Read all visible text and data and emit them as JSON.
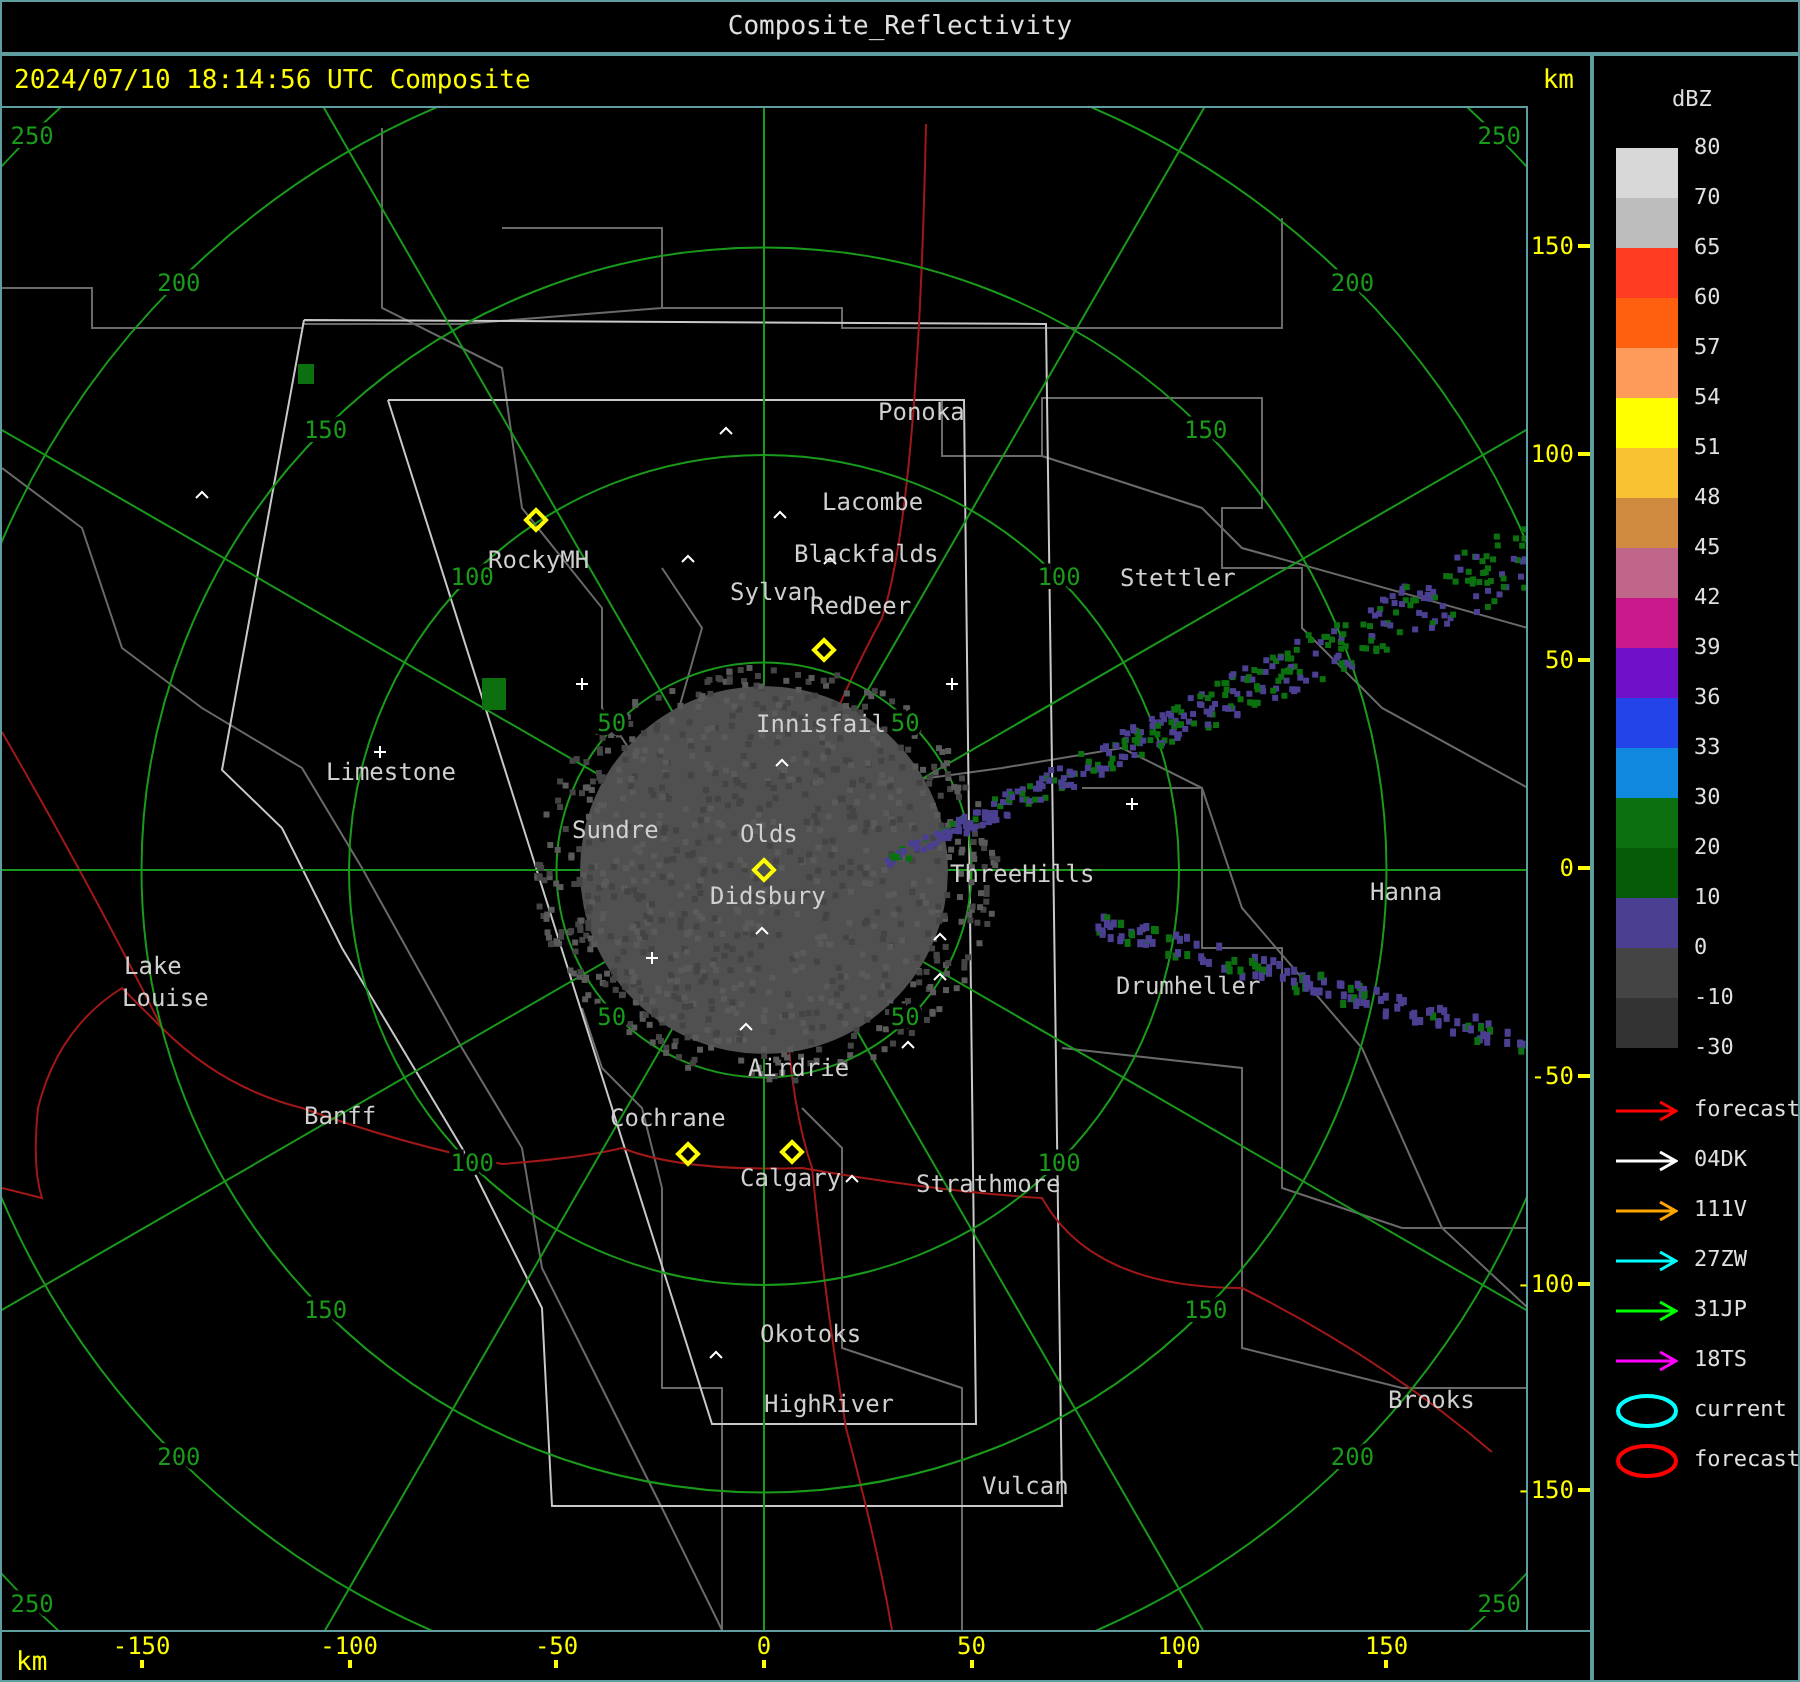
{
  "window": {
    "title": "Composite_Reflectivity"
  },
  "header": {
    "timestamp": "2024/07/10 18:14:56 UTC Composite",
    "unit": "km"
  },
  "map": {
    "range_labels": [
      "250",
      "200",
      "150",
      "100",
      "50",
      "50",
      "100",
      "150",
      "200",
      "250",
      "250",
      "200",
      "150",
      "100",
      "50",
      "50",
      "100",
      "150",
      "200",
      "250"
    ],
    "places": [
      "Ponoka",
      "Lacombe",
      "Blackfalds",
      "RockyMH",
      "Stettler",
      "Sylvan",
      "RedDeer",
      "Innisfail",
      "Limestone",
      "Sundre",
      "Olds",
      "ThreeHills",
      "Hanna",
      "Didsbury",
      "Lake",
      "Drumheller",
      "Louise",
      "Airdrie",
      "Banff",
      "Cochrane",
      "Calgary",
      "Strathmore",
      "Okotoks",
      "Brooks",
      "HighRiver",
      "Vulcan"
    ]
  },
  "y_axis": {
    "ticks": [
      "150",
      "100",
      "50",
      "0",
      "-50",
      "-100",
      "-150"
    ]
  },
  "x_axis": {
    "unit": "km",
    "ticks": [
      "-150",
      "-100",
      "-50",
      "0",
      "50",
      "100",
      "150"
    ]
  },
  "legend": {
    "unit": "dBZ",
    "bands": [
      {
        "label": "80",
        "color": "#d8d8d8"
      },
      {
        "label": "70",
        "color": "#bdbdbd"
      },
      {
        "label": "65",
        "color": "#ff3c22"
      },
      {
        "label": "60",
        "color": "#ff6010"
      },
      {
        "label": "57",
        "color": "#ff9b5a"
      },
      {
        "label": "54",
        "color": "#ffff00"
      },
      {
        "label": "51",
        "color": "#f8c233"
      },
      {
        "label": "48",
        "color": "#cf8a40"
      },
      {
        "label": "45",
        "color": "#c0668a"
      },
      {
        "label": "42",
        "color": "#c8188a"
      },
      {
        "label": "39",
        "color": "#7010c8"
      },
      {
        "label": "36",
        "color": "#2244e8"
      },
      {
        "label": "33",
        "color": "#1088e0"
      },
      {
        "label": "30",
        "color": "#0c7010"
      },
      {
        "label": "20",
        "color": "#055a05"
      },
      {
        "label": "10",
        "color": "#4a3f90"
      },
      {
        "label": "0",
        "color": "#444444"
      },
      {
        "label": "-10",
        "color": "#333333"
      }
    ],
    "bottom_label": "-30",
    "tracks": [
      {
        "kind": "arrow",
        "label": "forecast",
        "color": "#ff0000"
      },
      {
        "kind": "arrow",
        "label": "04DK",
        "color": "#ffffff"
      },
      {
        "kind": "arrow",
        "label": "111V",
        "color": "#ffa500"
      },
      {
        "kind": "arrow",
        "label": "27ZW",
        "color": "#00ffff"
      },
      {
        "kind": "arrow",
        "label": "31JP",
        "color": "#00ff00"
      },
      {
        "kind": "arrow",
        "label": "18TS",
        "color": "#ff00ff"
      },
      {
        "kind": "ellipse",
        "label": "current",
        "color": "#00ffff"
      },
      {
        "kind": "ellipse",
        "label": "forecast",
        "color": "#ff0000"
      }
    ]
  }
}
